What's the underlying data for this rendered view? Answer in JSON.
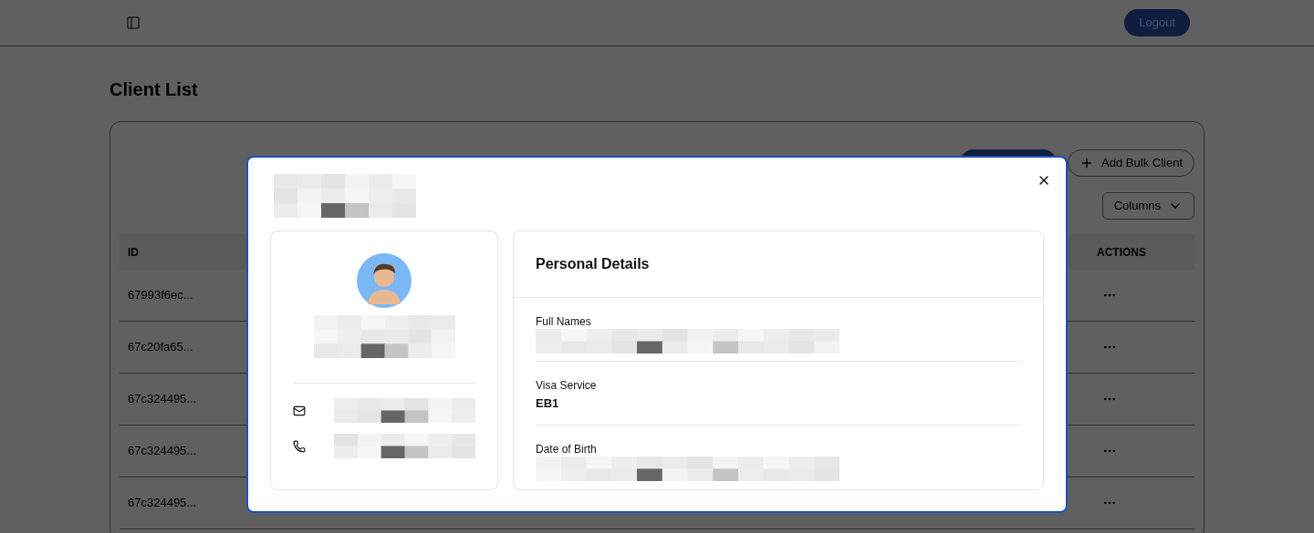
{
  "header": {
    "logout": "Logout"
  },
  "page": {
    "title": "Client List"
  },
  "toolbar": {
    "add_bulk": "Add Bulk Client",
    "columns": "Columns"
  },
  "table": {
    "columns": [
      {
        "label": "ID"
      },
      {
        "label": "ACTIONS"
      }
    ],
    "rows": [
      {
        "id": "67993f6ec..."
      },
      {
        "id": "67c20fa65..."
      },
      {
        "id": "67c324495..."
      },
      {
        "id": "67c324495..."
      },
      {
        "id": "67c324495..."
      }
    ]
  },
  "modal": {
    "contacts": [
      {
        "kind": "email"
      },
      {
        "kind": "phone"
      }
    ],
    "section_title": "Personal Details",
    "fields": [
      {
        "label": "Full Names",
        "kind": "redacted"
      },
      {
        "label": "Visa Service",
        "kind": "text",
        "value": "EB1"
      },
      {
        "label": "Date of Birth",
        "kind": "redacted"
      }
    ]
  }
}
